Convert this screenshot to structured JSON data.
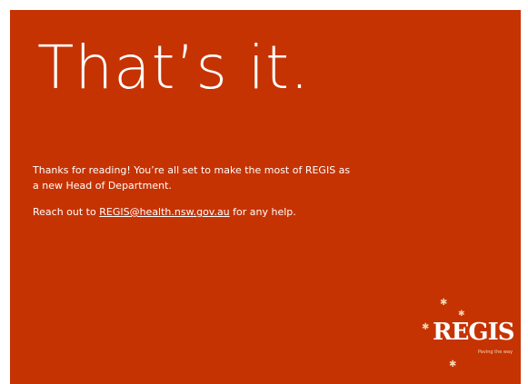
{
  "slide": {
    "headline": "That’s it.",
    "paragraph_1": "Thanks for reading! You’re all set to make the most of REGIS as a new Head of Department.",
    "paragraph_2_prefix": "Reach out to ",
    "email": "REGIS@health.nsw.gov.au",
    "paragraph_2_suffix": " for any help."
  },
  "logo": {
    "name": "REGIS",
    "tagline": "Paving the way",
    "icon": "star-icon"
  },
  "colors": {
    "background": "#c63302",
    "text": "#ffffff",
    "accent": "#f2d9b5"
  }
}
